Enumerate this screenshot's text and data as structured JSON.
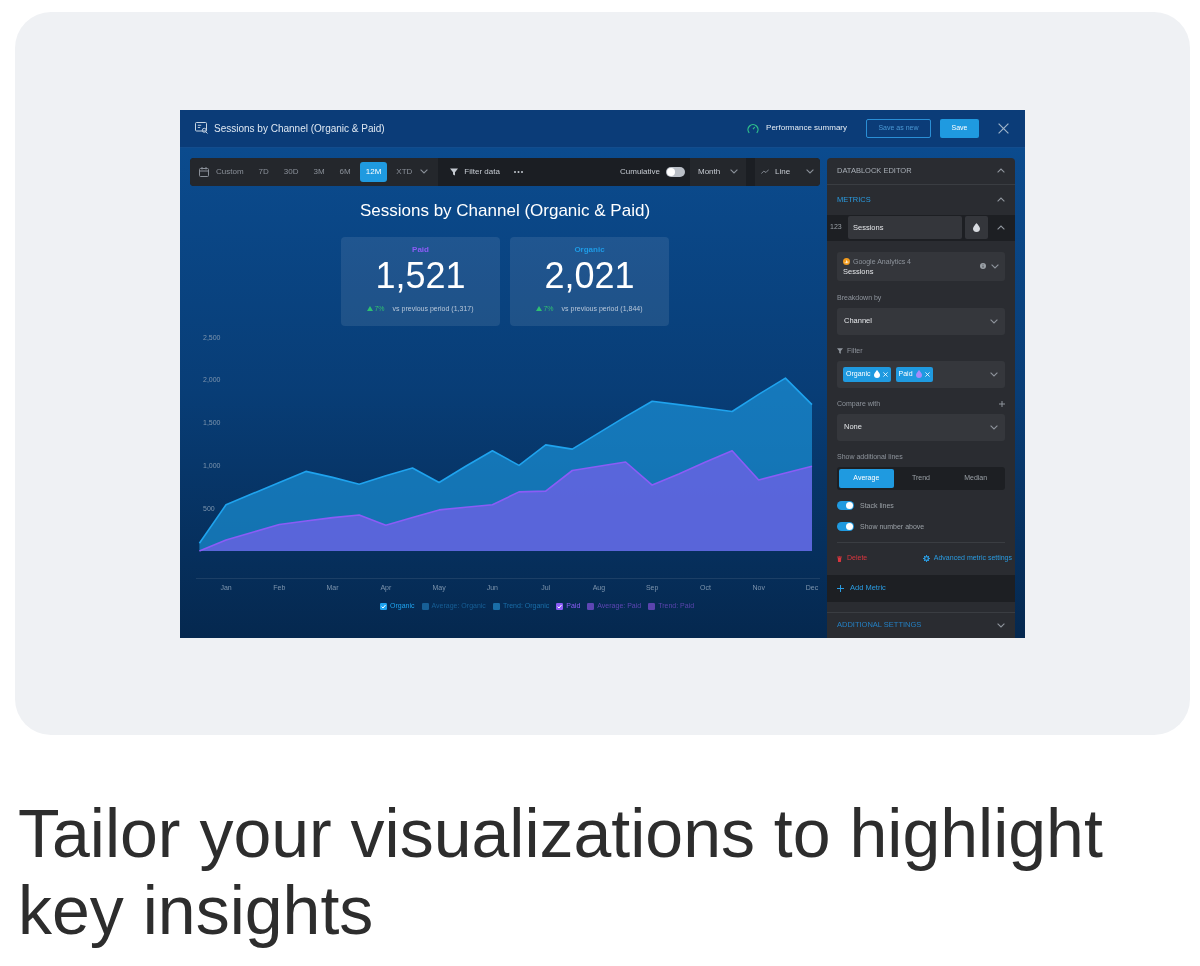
{
  "window": {
    "title": "Sessions by Channel (Organic & Paid)",
    "actions": [
      {
        "kind": "link",
        "label": "Performance summary"
      },
      {
        "kind": "outline",
        "label": "Save as new"
      },
      {
        "kind": "primary",
        "label": "Save"
      }
    ]
  },
  "toolbar": {
    "ranges": [
      {
        "label": "Custom",
        "selected": false
      },
      {
        "label": "7D",
        "selected": false
      },
      {
        "label": "30D",
        "selected": false
      },
      {
        "label": "3M",
        "selected": false
      },
      {
        "label": "6M",
        "selected": false
      },
      {
        "label": "12M",
        "selected": true
      },
      {
        "label": "XTD",
        "selected": false
      }
    ],
    "filter": "Filter data",
    "cumulative": {
      "label": "Cumulative",
      "on": false
    },
    "interval": "Month",
    "chart_type": "Line"
  },
  "chart": {
    "title": "Sessions by Channel (Organic & Paid)",
    "kpis": [
      {
        "label": "Paid",
        "color": "#8b5cf6",
        "value": "1,521",
        "change": "7%",
        "comparison": "vs previous period (1,317)"
      },
      {
        "label": "Organic",
        "color": "#1e9be6",
        "value": "2,021",
        "change": "7%",
        "comparison": "vs previous period (1,844)"
      }
    ],
    "chart_data": {
      "type": "area",
      "stacked": false,
      "categories": [
        null,
        "Jan",
        null,
        "Feb",
        null,
        "Mar",
        null,
        "Apr",
        null,
        "May",
        null,
        "Jun",
        null,
        "Jul",
        null,
        "Aug",
        null,
        "Sep",
        null,
        "Oct",
        null,
        "Nov",
        null,
        "Dec"
      ],
      "series": [
        {
          "name": "Organic",
          "color": "#1fa3ee",
          "values": [
            90,
            540,
            670,
            800,
            930,
            860,
            780,
            880,
            970,
            800,
            990,
            1170,
            1000,
            1240,
            1190,
            1380,
            1570,
            1750,
            1710,
            1670,
            1630,
            1830,
            2020,
            1710
          ]
        },
        {
          "name": "Paid",
          "color": "#8b5cf6",
          "values": [
            0,
            130,
            220,
            310,
            350,
            390,
            420,
            300,
            390,
            480,
            510,
            540,
            690,
            700,
            940,
            990,
            1040,
            770,
            900,
            1040,
            1170,
            830,
            910,
            990
          ]
        }
      ],
      "ylim": [
        0,
        2500
      ],
      "yticks": [
        {
          "value": 500,
          "label": "500"
        },
        {
          "value": 1000,
          "label": "1,000"
        },
        {
          "value": 1500,
          "label": "1,500"
        },
        {
          "value": 2000,
          "label": "2,000"
        },
        {
          "value": 2500,
          "label": "2,500"
        }
      ]
    },
    "legend": [
      {
        "kind": "series",
        "checked": true
      },
      {
        "kind": "line",
        "label": "Average: Organic",
        "checked": false,
        "color": "#175f96"
      },
      {
        "kind": "line",
        "label": "Trend: Organic",
        "checked": false,
        "color": "#1a6ea8"
      },
      {
        "kind": "series",
        "checked": true
      },
      {
        "kind": "line",
        "label": "Average: Paid",
        "checked": false,
        "color": "#5e46b4"
      },
      {
        "kind": "line",
        "label": "Trend: Paid",
        "checked": false,
        "color": "#5a44ad"
      }
    ]
  },
  "editor": {
    "title": "DATABLOCK EDITOR",
    "expanded": true,
    "metrics": {
      "title": "METRICS",
      "expanded": true,
      "items": [
        {
          "type_label": "123",
          "name": "Sessions",
          "expanded": true,
          "source": "Google Analytics 4",
          "field": "Sessions",
          "breakdown_label": "Breakdown by",
          "breakdown": "Channel",
          "filter_label": "Filter",
          "filters": [
            {
              "label": "Organic",
              "color": "#ffffff"
            },
            {
              "label": "Paid",
              "color": "#a78bfa"
            }
          ],
          "compare_label": "Compare with",
          "compare": "None",
          "lines_label": "Show additional lines",
          "lines": [
            {
              "label": "Average",
              "selected": true
            },
            {
              "label": "Trend",
              "selected": false
            },
            {
              "label": "Median",
              "selected": false
            }
          ],
          "toggles": [
            {
              "label": "Stack lines",
              "on": true
            },
            {
              "label": "Show number above",
              "on": true
            }
          ],
          "delete": "Delete",
          "advanced": "Advanced metric settings"
        }
      ],
      "add": "Add Metric"
    },
    "additional_settings": {
      "title": "ADDITIONAL SETTINGS",
      "expanded": false
    }
  },
  "heading": "Tailor your visualizations to highlight key insights"
}
